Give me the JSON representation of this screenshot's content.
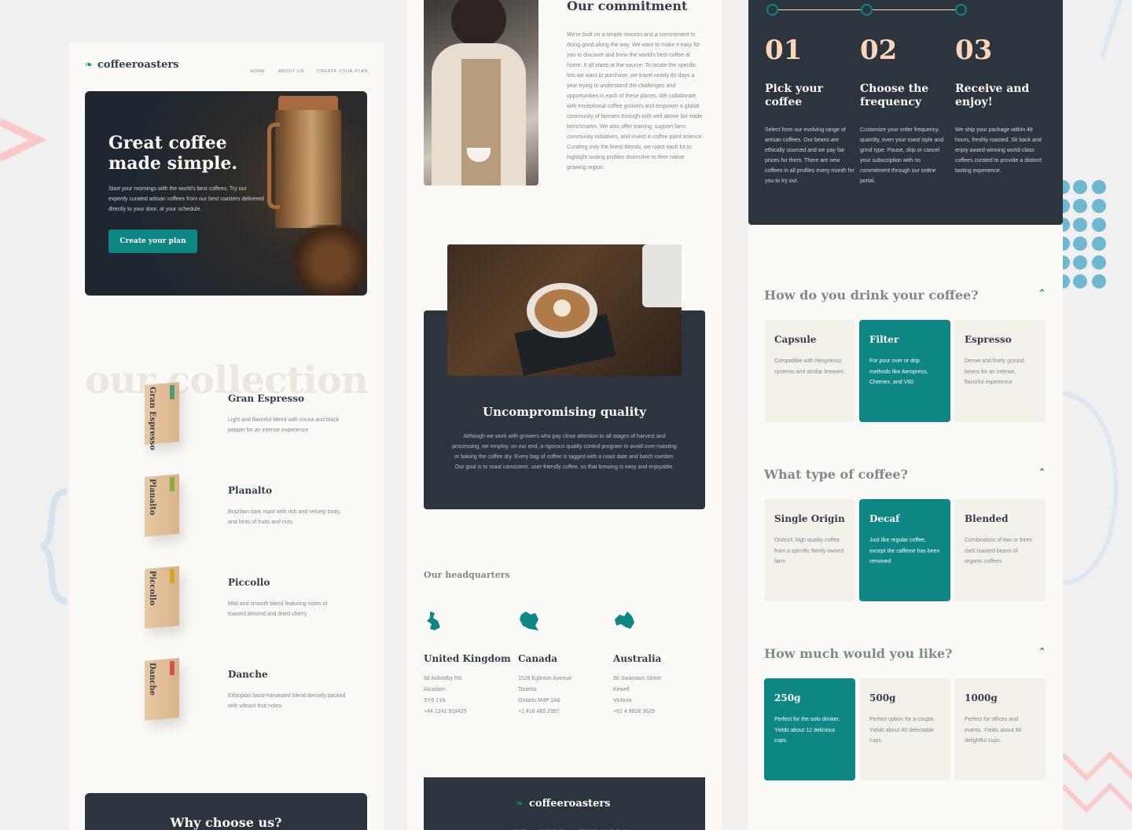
{
  "colors": {
    "accent": "#0e8784",
    "dark": "#2c343e",
    "cream": "#fcfaf6",
    "peach": "#fdd6ba"
  },
  "brand": {
    "logo_text": "coffeeroasters"
  },
  "nav": {
    "home": "HOME",
    "about": "ABOUT US",
    "create": "CREATE YOUR PLAN"
  },
  "hero": {
    "title_line1": "Great coffee",
    "title_line2": "made simple.",
    "body": "Start your mornings with the world's best coffees. Try our expertly curated artisan coffees from our best roasters delivered directly to your door, at your schedule.",
    "cta": "Create your plan"
  },
  "collection": {
    "heading": "our collection",
    "items": [
      {
        "name": "Gran Espresso",
        "desc": "Light and flavorful blend with cocoa and black pepper for an intense experience"
      },
      {
        "name": "Planalto",
        "desc": "Brazilian dark roast with rich and velvety body, and hints of fruits and nuts"
      },
      {
        "name": "Piccollo",
        "desc": "Mild and smooth blend featuring notes of toasted almond and dried cherry"
      },
      {
        "name": "Danche",
        "desc": "Ethiopian hand-harvested blend densely packed with vibrant fruit notes"
      }
    ]
  },
  "why": {
    "heading": "Why choose us?"
  },
  "commitment": {
    "heading": "Our commitment",
    "body": "We're built on a simple mission and a commitment to doing good along the way. We want to make it easy for you to discover and brew the world's best coffee at home. It all starts at the source. To locate the specific lots we want to purchase, we travel nearly 60 days a year trying to understand the challenges and opportunities in each of these places. We collaborate with exceptional coffee growers and empower a global community of farmers through with well above fair-trade benchmarks. We also offer training, support farm community initiatives, and invest in coffee plant science. Curating only the finest blends, we roast each lot to highlight tasting profiles distinctive to their native growing region."
  },
  "quality": {
    "heading": "Uncompromising quality",
    "body": "Although we work with growers who pay close attention to all stages of harvest and processing, we employ, on our end, a rigorous quality control program to avoid over-roasting or baking the coffee dry. Every bag of coffee is tagged with a roast date and batch number. Our goal is to roast consistent, user-friendly coffee, so that brewing is easy and enjoyable."
  },
  "hq": {
    "heading": "Our headquarters",
    "locations": [
      {
        "country": "United Kingdom",
        "lines": [
          "68 Asfordby Rd",
          "Alcaston",
          "SY6 1YA",
          "+44 1241 918425"
        ]
      },
      {
        "country": "Canada",
        "lines": [
          "1528  Eglinton Avenue",
          "Toronto",
          "Ontario M4P 1A6",
          "+1 416 485 2997"
        ]
      },
      {
        "country": "Australia",
        "lines": [
          "36 Swanston Street",
          "Kewell",
          "Victoria",
          "+61 4 9928 3629"
        ]
      }
    ]
  },
  "steps": [
    {
      "num": "01",
      "title_line1": "Pick your",
      "title_line2": "coffee",
      "desc": "Select from our evolving range of artisan coffees. Our beans are ethically sourced and we pay fair prices for them. There are new coffees in all profiles every month for you to try out."
    },
    {
      "num": "02",
      "title_line1": "Choose the",
      "title_line2": "frequency",
      "desc": "Customize your order frequency, quantity, even your roast style and grind type. Pause, skip or cancel your subscription with no commitment through our online portal."
    },
    {
      "num": "03",
      "title_line1": "Receive and",
      "title_line2": "enjoy!",
      "desc": "We ship your package within 48 hours, freshly roasted. Sit back and enjoy award-winning world-class coffees curated to provide a distinct tasting experience."
    }
  ],
  "questions": [
    {
      "q": "How do you drink your coffee?",
      "selected": 1,
      "options": [
        {
          "title": "Capsule",
          "desc": "Compatible with Nespresso systems and similar brewers"
        },
        {
          "title": "Filter",
          "desc": "For pour over or drip methods like Aeropress, Chemex, and V60"
        },
        {
          "title": "Espresso",
          "desc": "Dense and finely ground beans for an intense, flavorful experience"
        }
      ]
    },
    {
      "q": "What type of coffee?",
      "selected": 1,
      "options": [
        {
          "title": "Single Origin",
          "desc": "Distinct, high quality coffee from a specific family-owned farm"
        },
        {
          "title": "Decaf",
          "desc": "Just like regular coffee, except the caffeine has been removed"
        },
        {
          "title": "Blended",
          "desc": "Combination of two or three dark roasted beans of organic coffees"
        }
      ]
    },
    {
      "q": "How much would you like?",
      "selected": 0,
      "options": [
        {
          "title": "250g",
          "desc": "Perfect for the solo drinker. Yields about 12 delicious cups."
        },
        {
          "title": "500g",
          "desc": "Perfect option for a couple. Yields about 40 delectable cups."
        },
        {
          "title": "1000g",
          "desc": "Perfect for offices and events. Yields about 90 delightful cups."
        }
      ]
    }
  ]
}
